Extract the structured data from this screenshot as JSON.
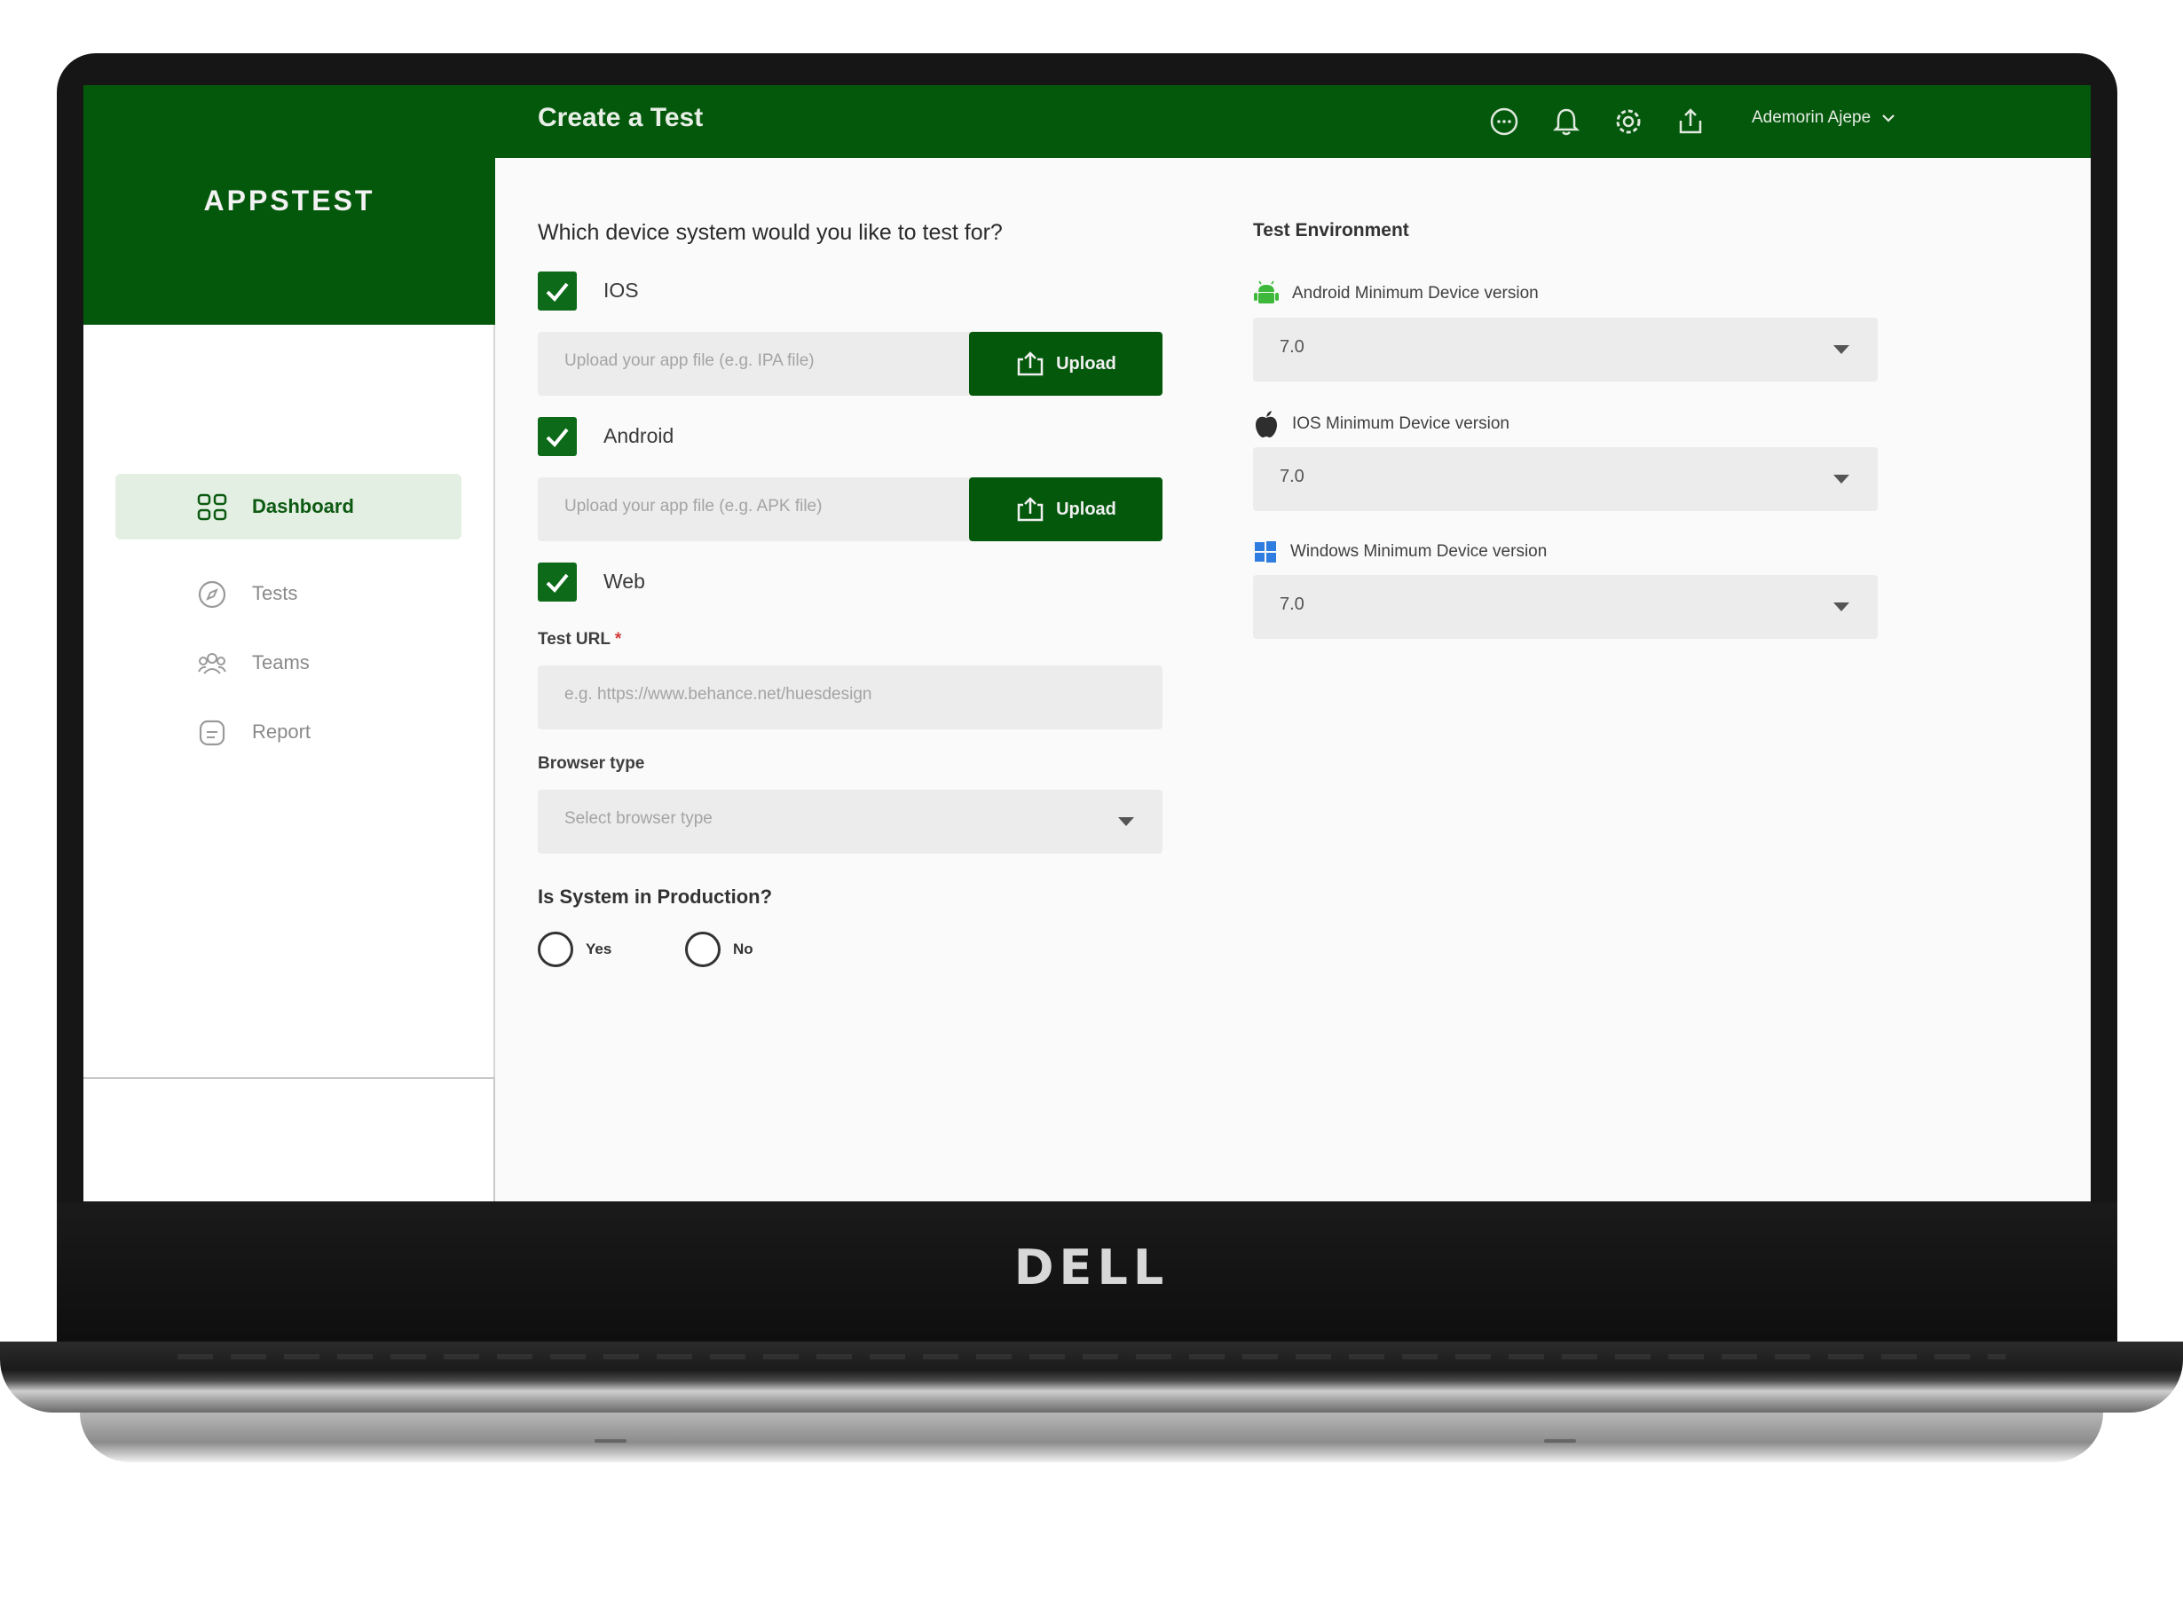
{
  "app": {
    "brand": "APPSTEST",
    "page_title": "Create a Test",
    "user_name": "Ademorin Ajepe"
  },
  "device_logo": "DELL",
  "header_icons": [
    "chat-icon",
    "bell-icon",
    "gear-icon",
    "share-icon"
  ],
  "sidebar": {
    "items": [
      {
        "label": "Dashboard",
        "icon": "grid-icon",
        "active": true
      },
      {
        "label": "Tests",
        "icon": "compass-icon",
        "active": false
      },
      {
        "label": "Teams",
        "icon": "team-icon",
        "active": false
      },
      {
        "label": "Report",
        "icon": "report-icon",
        "active": false
      }
    ]
  },
  "form": {
    "question": "Which device system would you like to test for?",
    "ios": {
      "label": "IOS",
      "checked": true,
      "upload_placeholder": "Upload your app file (e.g. IPA file)",
      "button": "Upload"
    },
    "android": {
      "label": "Android",
      "checked": true,
      "upload_placeholder": "Upload your app file (e.g. APK file)",
      "button": "Upload"
    },
    "web": {
      "label": "Web",
      "checked": true
    },
    "test_url": {
      "label": "Test URL",
      "required_mark": "*",
      "placeholder": "e.g. https://www.behance.net/huesdesign"
    },
    "browser": {
      "label": "Browser type",
      "placeholder": "Select browser type"
    },
    "production": {
      "question": "Is System in Production?",
      "yes": "Yes",
      "no": "No"
    }
  },
  "environment": {
    "title": "Test Environment",
    "android": {
      "label": "Android Minimum Device version",
      "value": "7.0"
    },
    "ios": {
      "label": "IOS Minimum Device version",
      "value": "7.0"
    },
    "windows": {
      "label": "Windows Minimum Device version",
      "value": "7.0"
    }
  },
  "colors": {
    "primary": "#04580c",
    "active_nav_bg": "#e3efe2",
    "field_bg": "#ececec",
    "android_green": "#3db83a",
    "windows_blue": "#2f7de1"
  }
}
